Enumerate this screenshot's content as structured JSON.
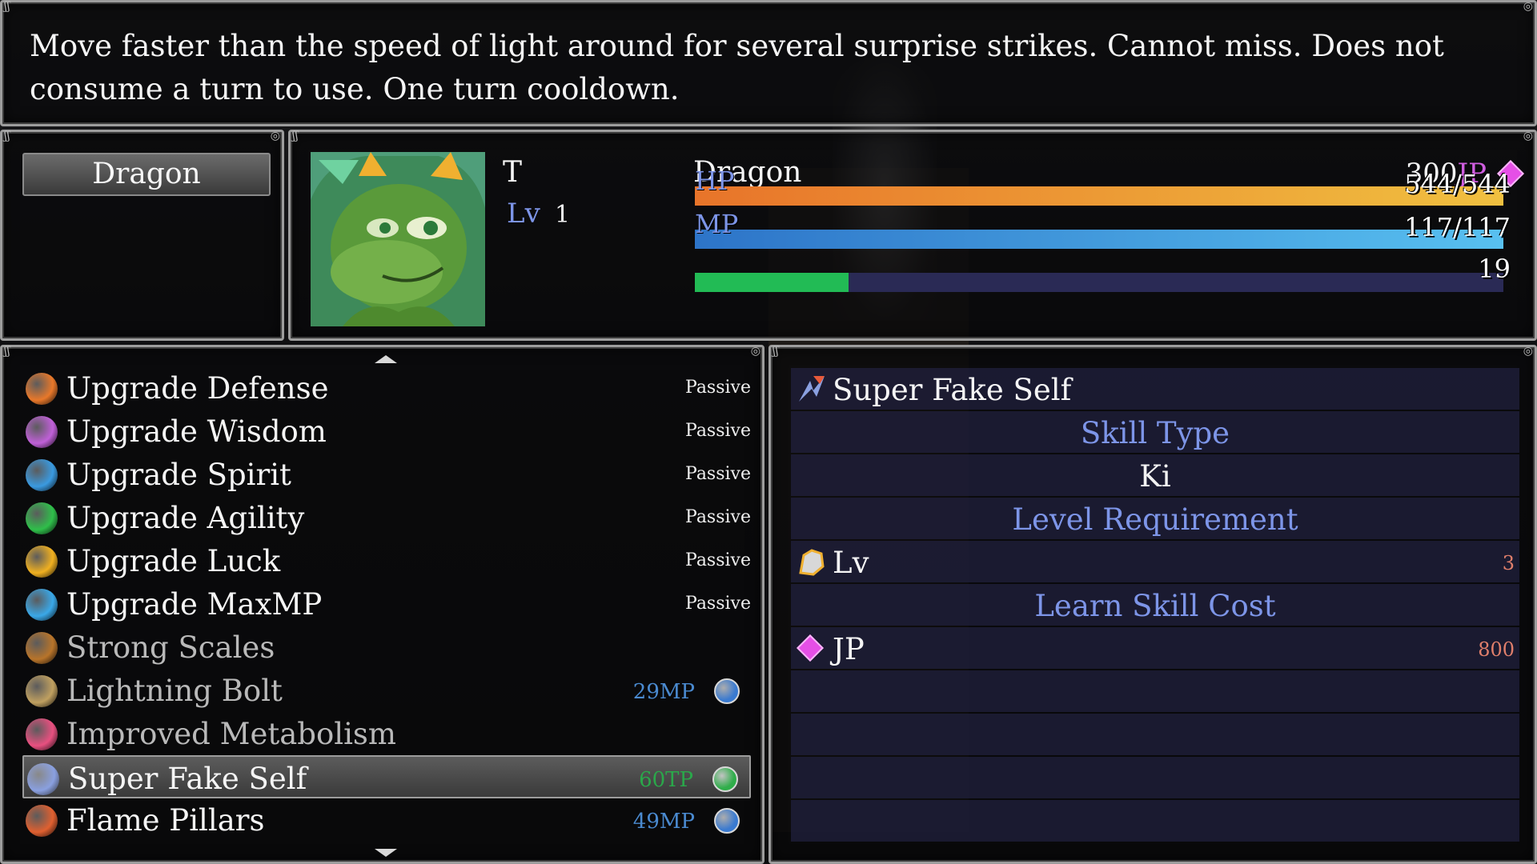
{
  "help": {
    "description": "Move faster than the speed of light around for several surprise strikes. Cannot miss. Does not consume a turn to use. One turn cooldown."
  },
  "class_list": {
    "selected": "Dragon"
  },
  "status": {
    "name": "T",
    "level_label": "Lv",
    "level": "1",
    "class_name": "Dragon",
    "jp_value": "300",
    "jp_unit": "JP",
    "hp_label": "HP",
    "hp_value": "544/544",
    "hp_ratio": 1.0,
    "mp_label": "MP",
    "mp_value": "117/117",
    "mp_ratio": 1.0,
    "tp_value": "19",
    "tp_ratio": 0.19,
    "colors": {
      "hp_gradient": [
        "#e8742a",
        "#f0c040"
      ],
      "mp_gradient": [
        "#2d74c8",
        "#58c0f0"
      ],
      "tp_fill": "#22bb55",
      "gauge_back": "#2a2a55"
    }
  },
  "skills": [
    {
      "name": "Upgrade Defense",
      "cost": "Passive",
      "icon": "orange-plus-shield-icon",
      "icon_color": "#e8782a",
      "dim": false,
      "selected": false
    },
    {
      "name": "Upgrade Wisdom",
      "cost": "Passive",
      "icon": "purple-plus-icon",
      "icon_color": "#c060d8",
      "dim": false,
      "selected": false
    },
    {
      "name": "Upgrade Spirit",
      "cost": "Passive",
      "icon": "blue-plus-icon",
      "icon_color": "#3a9ae0",
      "dim": false,
      "selected": false
    },
    {
      "name": "Upgrade Agility",
      "cost": "Passive",
      "icon": "green-plus-icon",
      "icon_color": "#2fbf4a",
      "dim": false,
      "selected": false
    },
    {
      "name": "Upgrade Luck",
      "cost": "Passive",
      "icon": "yellow-plus-icon",
      "icon_color": "#f0b020",
      "dim": false,
      "selected": false
    },
    {
      "name": "Upgrade MaxMP",
      "cost": "Passive",
      "icon": "cyan-plus-icon",
      "icon_color": "#3aa8e8",
      "dim": false,
      "selected": false
    },
    {
      "name": "Strong Scales",
      "cost": "",
      "icon": "scales-icon",
      "icon_color": "#b8742a",
      "dim": true,
      "selected": false
    },
    {
      "name": "Lightning Bolt",
      "cost": "29MP",
      "icon": "lightning-bolt-icon",
      "icon_color": "#c0a060",
      "dim": true,
      "selected": false,
      "cost_color": "#4a8ad0",
      "orb_color": "#3a7ad0"
    },
    {
      "name": "Improved Metabolism",
      "cost": "",
      "icon": "heart-icon",
      "icon_color": "#e85080",
      "dim": true,
      "selected": false
    },
    {
      "name": "Super Fake Self",
      "cost": "60TP",
      "icon": "fake-self-icon",
      "icon_color": "#8aa0e0",
      "dim": false,
      "selected": true,
      "cost_color": "#2aa84a",
      "orb_color": "#2fae4a"
    },
    {
      "name": "Flame Pillars",
      "cost": "49MP",
      "icon": "flame-icon",
      "icon_color": "#e06030",
      "dim": false,
      "selected": false,
      "cost_color": "#4a8ad0",
      "orb_color": "#3a7ad0"
    }
  ],
  "detail": {
    "skill_name": "Super Fake Self",
    "skill_type_header": "Skill Type",
    "skill_type": "Ki",
    "level_req_header": "Level Requirement",
    "level_req_label": "Lv",
    "level_req_value": "3",
    "cost_header": "Learn Skill Cost",
    "cost_label": "JP",
    "cost_value": "800"
  }
}
